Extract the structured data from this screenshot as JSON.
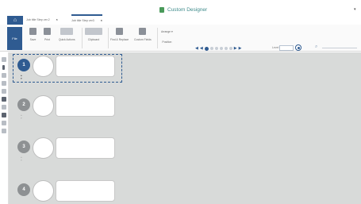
{
  "app": {
    "title": "Custom Designer"
  },
  "tabs": [
    {
      "label": "Job title Step ver.2"
    },
    {
      "label": "Job title Step ver3"
    }
  ],
  "ribbon": {
    "file_label": "File",
    "buttons": [
      {
        "label": "Save"
      },
      {
        "label": "Print"
      },
      {
        "label": "Quick Actions"
      },
      {
        "label": "Clipboard"
      },
      {
        "label": "Find & Replace"
      },
      {
        "label": "Custom Fields"
      }
    ],
    "arrange": {
      "label": "Arrange ▾",
      "sublabel": "Position"
    }
  },
  "nav": {
    "level_label": "Level"
  },
  "steps": [
    {
      "number": "1",
      "selected": true
    },
    {
      "number": "2",
      "selected": false
    },
    {
      "number": "3",
      "selected": false
    },
    {
      "number": "4",
      "selected": false
    }
  ]
}
